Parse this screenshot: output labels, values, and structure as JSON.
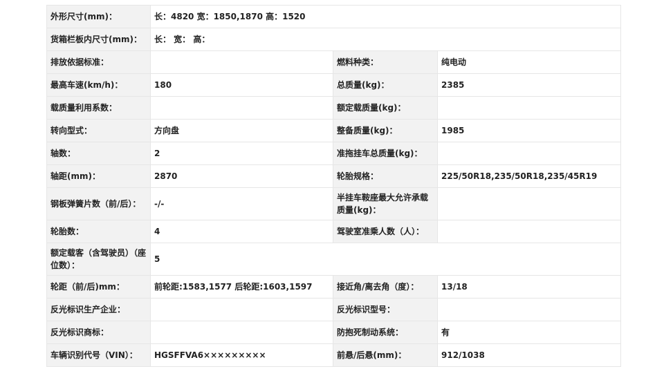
{
  "rows": [
    {
      "full": true,
      "label": "外形尺寸(mm)：",
      "value": "长：4820 宽：1850,1870 高：1520"
    },
    {
      "full": true,
      "label": "货箱栏板内尺寸(mm)：",
      "value": "长： 宽： 高："
    },
    {
      "full": false,
      "label1": "排放依据标准：",
      "value1": "",
      "label2": "燃料种类：",
      "value2": "纯电动"
    },
    {
      "full": false,
      "label1": "最高车速(km/h)：",
      "value1": "180",
      "label2": "总质量(kg)：",
      "value2": "2385"
    },
    {
      "full": false,
      "label1": "载质量利用系数：",
      "value1": "",
      "label2": "额定载质量(kg)：",
      "value2": ""
    },
    {
      "full": false,
      "label1": "转向型式：",
      "value1": "方向盘",
      "label2": "整备质量(kg)：",
      "value2": "1985"
    },
    {
      "full": false,
      "label1": "轴数：",
      "value1": "2",
      "label2": "准拖挂车总质量(kg)：",
      "value2": ""
    },
    {
      "full": false,
      "label1": "轴距(mm)：",
      "value1": "2870",
      "label2": "轮胎规格：",
      "value2": "225/50R18,235/50R18,235/45R19"
    },
    {
      "full": false,
      "tall": true,
      "label1": "钢板弹簧片数（前/后）：",
      "value1": "-/-",
      "label2": "半挂车鞍座最大允许承载质量(kg)：",
      "value2": ""
    },
    {
      "full": false,
      "label1": "轮胎数：",
      "value1": "4",
      "label2": "驾驶室准乘人数（人）：",
      "value2": ""
    },
    {
      "full": true,
      "tall": true,
      "label": "额定载客（含驾驶员）（座位数）：",
      "value": "5"
    },
    {
      "full": false,
      "label1": "轮距（前/后)mm：",
      "value1": "前轮距:1583,1577 后轮距:1603,1597",
      "label2": "接近角/离去角（度）：",
      "value2": "13/18"
    },
    {
      "full": false,
      "label1": "反光标识生产企业：",
      "value1": "",
      "label2": "反光标识型号：",
      "value2": ""
    },
    {
      "full": false,
      "label1": "反光标识商标：",
      "value1": "",
      "label2": "防抱死制动系统：",
      "value2": "有"
    },
    {
      "full": false,
      "label1": "车辆识别代号（VIN）：",
      "value1": "HGSFFVA6×××××××××",
      "label2": "前悬/后悬(mm)：",
      "value2": "912/1038"
    }
  ]
}
